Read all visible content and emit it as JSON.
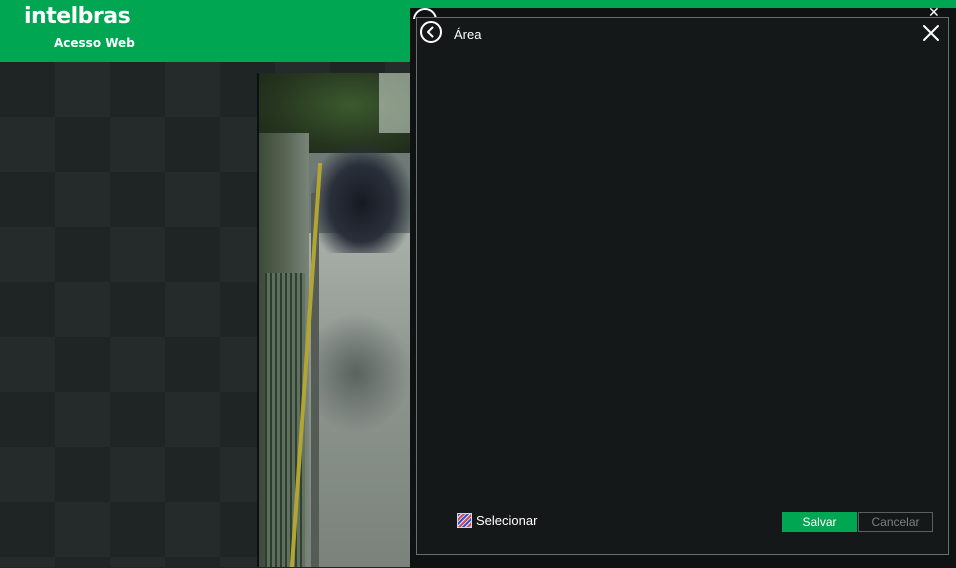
{
  "header": {
    "logo_text": "intelbras",
    "subtitle": "Acesso Web",
    "background_color": "#00a651"
  },
  "dialog": {
    "title": "Área",
    "back_icon": "chevron-left-circle-icon",
    "close_icon": "close-icon",
    "select_label": "Selecionar",
    "select_icon": "area-select-icon",
    "save_label": "Salvar",
    "cancel_label": "Cancelar",
    "accent_color": "#00a651"
  },
  "camera": {
    "content": "live-camera-feed"
  }
}
